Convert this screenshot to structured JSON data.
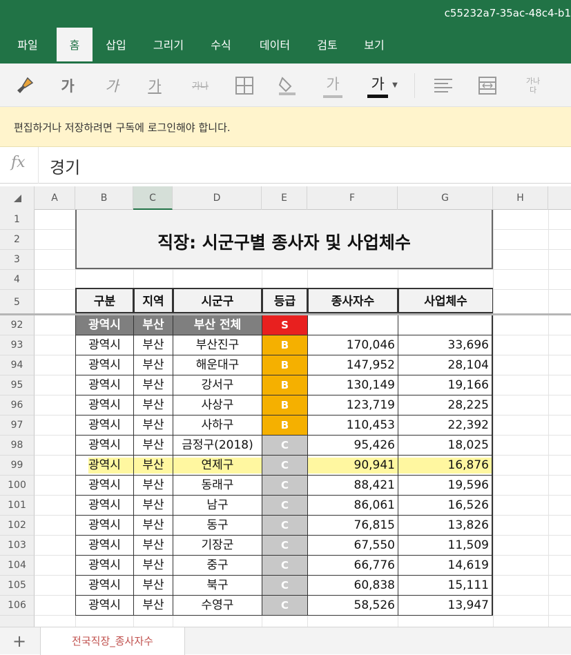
{
  "app": {
    "doc_id": "c55232a7-35ac-48c4-b1"
  },
  "ribbon": {
    "tabs": [
      {
        "label": "파일"
      },
      {
        "label": "홈"
      },
      {
        "label": "삽입"
      },
      {
        "label": "그리기"
      },
      {
        "label": "수식"
      },
      {
        "label": "데이터"
      },
      {
        "label": "검토"
      },
      {
        "label": "보기"
      }
    ],
    "active_tab": "홈",
    "tools": {
      "format_painter": "paintbrush-icon",
      "bold": "가",
      "italic": "가",
      "underline": "가",
      "strikethrough": "가나",
      "borders": "borders-icon",
      "fill_color": "fill-color-icon",
      "font_color_light": "가",
      "font_color": "가",
      "align": "align-left-icon",
      "merge": "merge-icon",
      "wrap": "가나\n다"
    },
    "accent": "#217346"
  },
  "notice": {
    "text": "편집하거나 저장하려면 구독에 로그인해야 합니다."
  },
  "formula_bar": {
    "fx": "fx",
    "value": "경기"
  },
  "columns": [
    "A",
    "B",
    "C",
    "D",
    "E",
    "F",
    "G",
    "H"
  ],
  "selected_column": "C",
  "sheet": {
    "title": "직장: 시군구별 종사자 및 사업체수",
    "header_row_numbers": [
      "1",
      "2",
      "3",
      "4",
      "5"
    ],
    "headers": [
      "구분",
      "지역",
      "시군구",
      "등급",
      "종사자수",
      "사업체수"
    ],
    "rows": [
      {
        "num": "92",
        "type": "광역시",
        "region": "부산",
        "district": "부산 전체",
        "grade": "S",
        "workers": "",
        "businesses": "",
        "summary": true
      },
      {
        "num": "93",
        "type": "광역시",
        "region": "부산",
        "district": "부산진구",
        "grade": "B",
        "workers": "170,046",
        "businesses": "33,696"
      },
      {
        "num": "94",
        "type": "광역시",
        "region": "부산",
        "district": "해운대구",
        "grade": "B",
        "workers": "147,952",
        "businesses": "28,104"
      },
      {
        "num": "95",
        "type": "광역시",
        "region": "부산",
        "district": "강서구",
        "grade": "B",
        "workers": "130,149",
        "businesses": "19,166"
      },
      {
        "num": "96",
        "type": "광역시",
        "region": "부산",
        "district": "사상구",
        "grade": "B",
        "workers": "123,719",
        "businesses": "28,225"
      },
      {
        "num": "97",
        "type": "광역시",
        "region": "부산",
        "district": "사하구",
        "grade": "B",
        "workers": "110,453",
        "businesses": "22,392"
      },
      {
        "num": "98",
        "type": "광역시",
        "region": "부산",
        "district": "금정구(2018)",
        "grade": "C",
        "workers": "95,426",
        "businesses": "18,025"
      },
      {
        "num": "99",
        "type": "광역시",
        "region": "부산",
        "district": "연제구",
        "grade": "C",
        "workers": "90,941",
        "businesses": "16,876",
        "highlight": true
      },
      {
        "num": "100",
        "type": "광역시",
        "region": "부산",
        "district": "동래구",
        "grade": "C",
        "workers": "88,421",
        "businesses": "19,596"
      },
      {
        "num": "101",
        "type": "광역시",
        "region": "부산",
        "district": "남구",
        "grade": "C",
        "workers": "86,061",
        "businesses": "16,526"
      },
      {
        "num": "102",
        "type": "광역시",
        "region": "부산",
        "district": "동구",
        "grade": "C",
        "workers": "76,815",
        "businesses": "13,826"
      },
      {
        "num": "103",
        "type": "광역시",
        "region": "부산",
        "district": "기장군",
        "grade": "C",
        "workers": "67,550",
        "businesses": "11,509"
      },
      {
        "num": "104",
        "type": "광역시",
        "region": "부산",
        "district": "중구",
        "grade": "C",
        "workers": "66,776",
        "businesses": "14,619"
      },
      {
        "num": "105",
        "type": "광역시",
        "region": "부산",
        "district": "북구",
        "grade": "C",
        "workers": "60,838",
        "businesses": "15,111"
      },
      {
        "num": "106",
        "type": "광역시",
        "region": "부산",
        "district": "수영구",
        "grade": "C",
        "workers": "58,526",
        "businesses": "13,947"
      }
    ],
    "grade_colors": {
      "S": "#e8201f",
      "B": "#f5b000",
      "C": "#c8c8c8"
    },
    "summary_color": "#7f7f7f",
    "highlight_color": "#fff68f"
  },
  "sheet_tabs": {
    "add": "+",
    "active": "전국직장_종사자수"
  }
}
